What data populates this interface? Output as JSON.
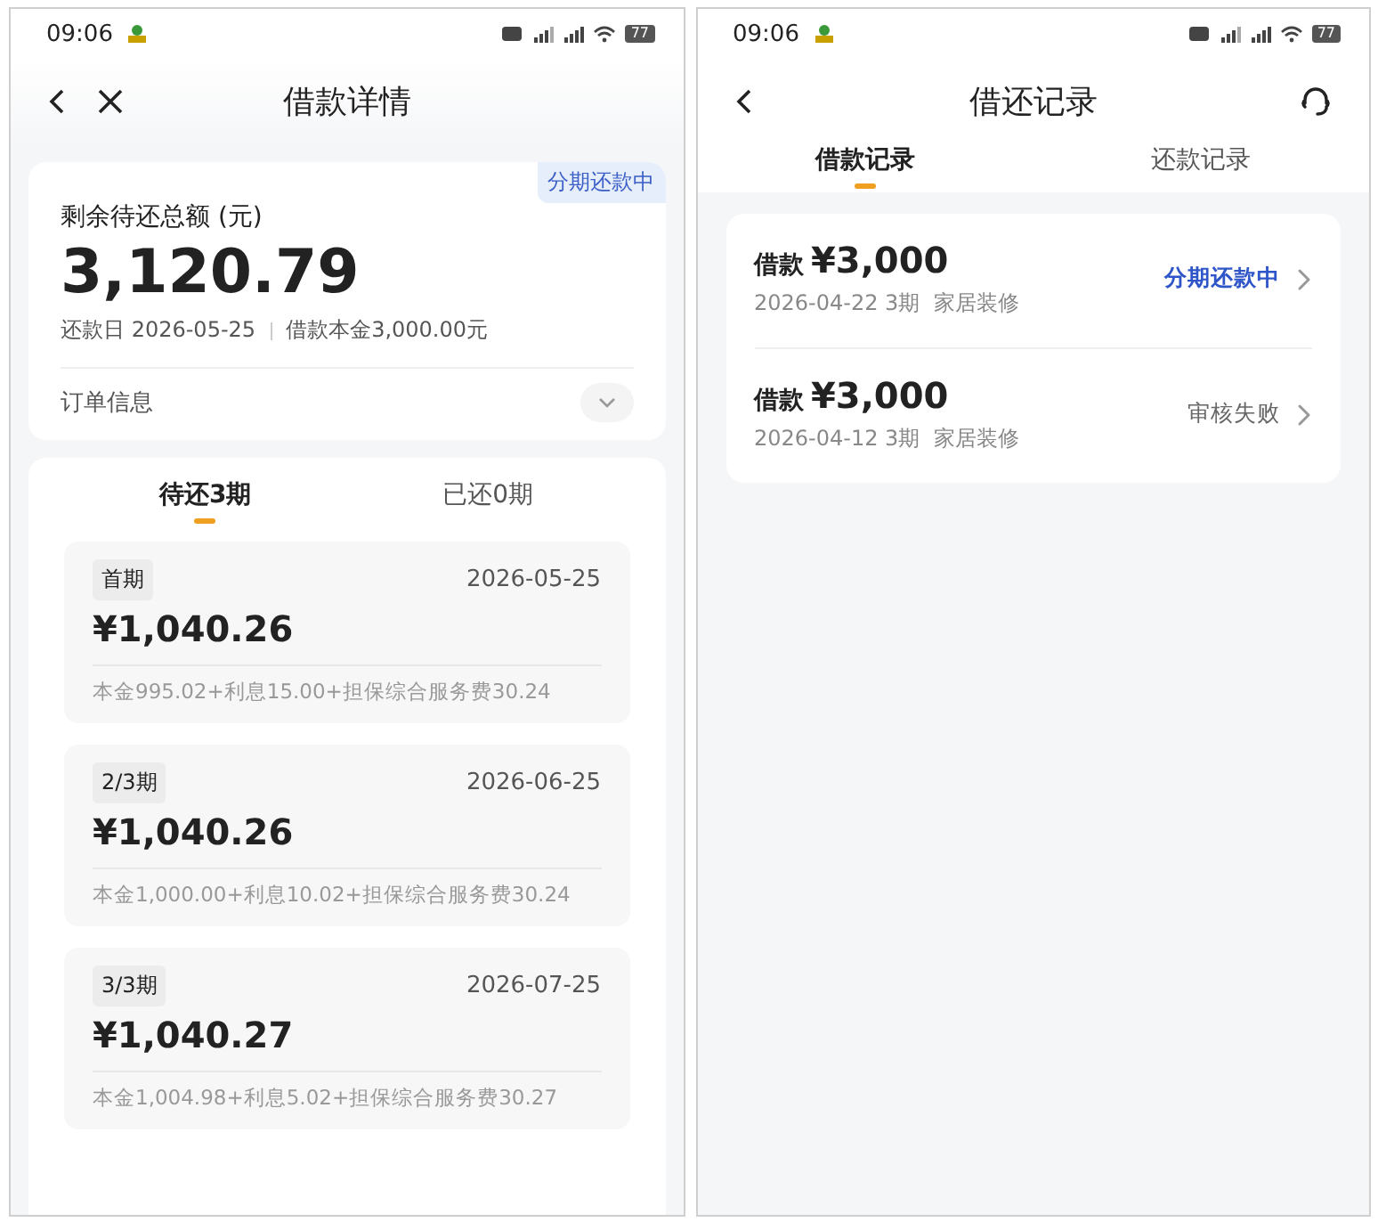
{
  "left_screen": {
    "status_bar": {
      "time": "09:06",
      "battery": "77"
    },
    "nav": {
      "title": "借款详情"
    },
    "summary": {
      "badge": "分期还款中",
      "label": "剩余待还总额 (元)",
      "amount": "3,120.79",
      "due_date": "还款日 2026-05-25",
      "principal": "借款本金3,000.00元",
      "order_info": "订单信息",
      "expanded": false
    },
    "tabs": [
      {
        "label": "待还3期",
        "selected": true
      },
      {
        "label": "已还0期",
        "selected": false
      }
    ],
    "installments": [
      {
        "period": "首期",
        "date": "2026-05-25",
        "amount": "¥1,040.26",
        "detail": "本金995.02+利息15.00+担保综合服务费30.24"
      },
      {
        "period": "2/3期",
        "date": "2026-06-25",
        "amount": "¥1,040.26",
        "detail": "本金1,000.00+利息10.02+担保综合服务费30.24"
      },
      {
        "period": "3/3期",
        "date": "2026-07-25",
        "amount": "¥1,040.27",
        "detail": "本金1,004.98+利息5.02+担保综合服务费30.27"
      }
    ]
  },
  "right_screen": {
    "status_bar": {
      "time": "09:06",
      "battery": "77"
    },
    "nav": {
      "title": "借还记录"
    },
    "tabs": [
      {
        "label": "借款记录",
        "selected": true
      },
      {
        "label": "还款记录",
        "selected": false
      }
    ],
    "records": [
      {
        "prefix": "借款",
        "amount": "¥3,000",
        "meta": "2026-04-22 3期  家居装修",
        "status": "分期还款中",
        "kind": "active"
      },
      {
        "prefix": "借款",
        "amount": "¥3,000",
        "meta": "2026-04-12 3期  家居装修",
        "status": "审核失败",
        "kind": "failed"
      }
    ]
  }
}
